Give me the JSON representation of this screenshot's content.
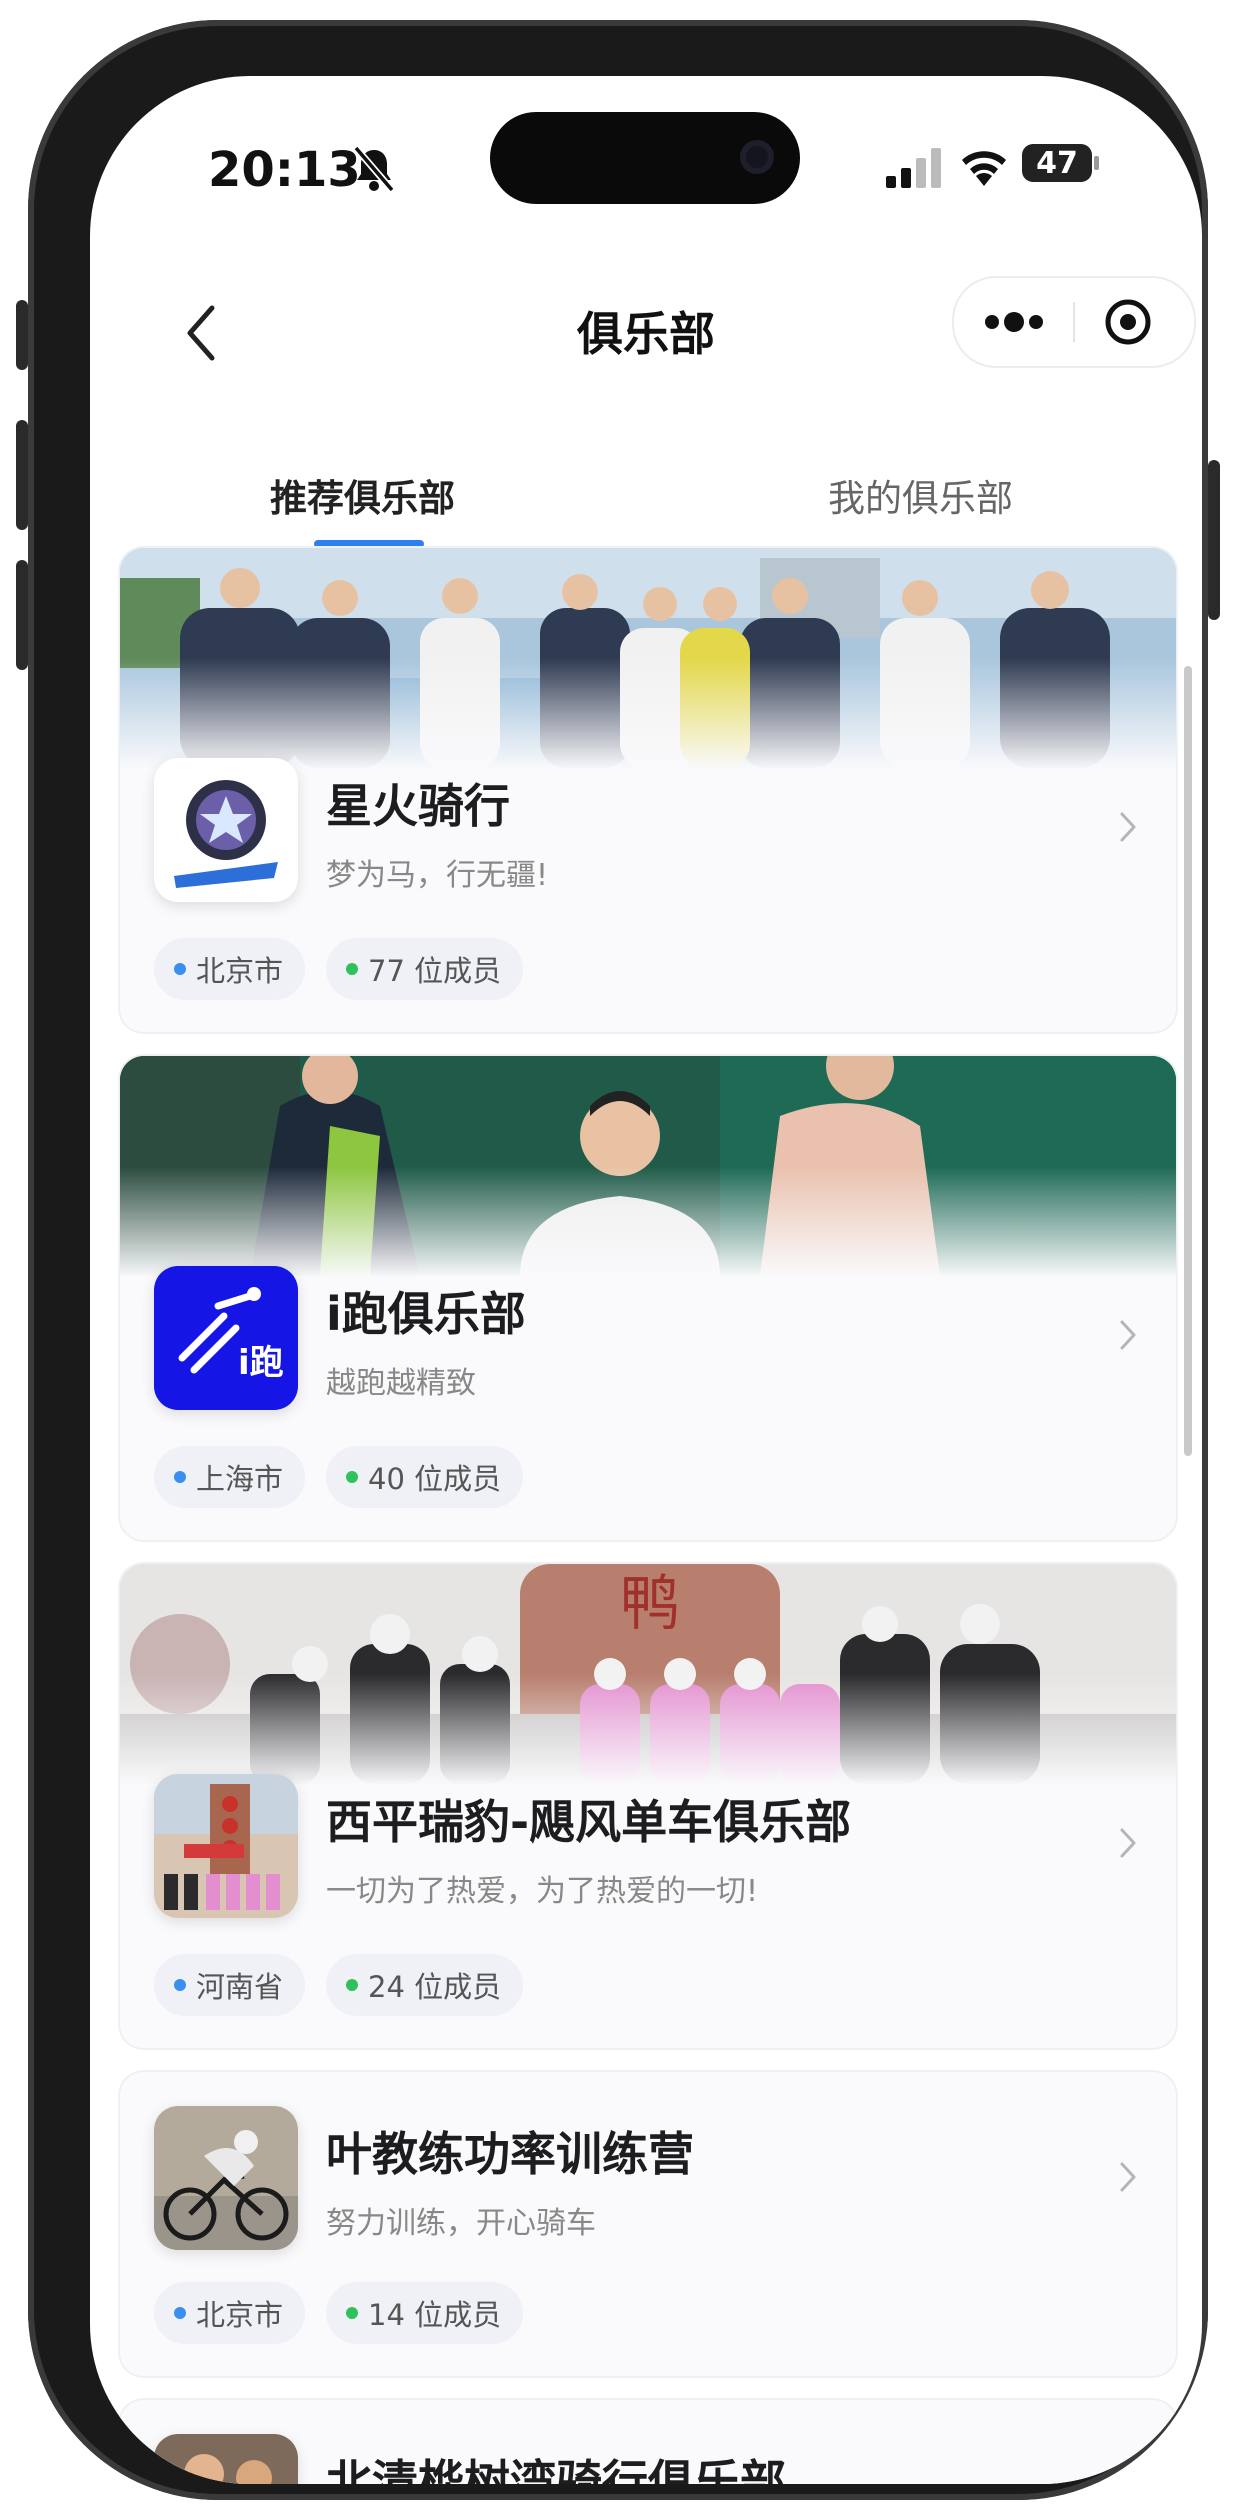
{
  "status_bar": {
    "time": "20:13",
    "battery": "47"
  },
  "nav": {
    "title": "俱乐部"
  },
  "tabs": [
    {
      "label": "推荐俱乐部",
      "active": true
    },
    {
      "label": "我的俱乐部",
      "active": false
    }
  ],
  "colors": {
    "accent": "#2f7ff0",
    "location_dot": "#3a8ef0",
    "members_dot": "#2fc25b"
  },
  "clubs": [
    {
      "name": "星火骑行",
      "slogan": "梦为马，行无疆!",
      "location": "北京市",
      "members": "77 位成员"
    },
    {
      "name": "i跑俱乐部",
      "slogan": "越跑越精致",
      "location": "上海市",
      "members": "40 位成员",
      "logo_text": "i跑"
    },
    {
      "name": "西平瑞豹-飓风单车俱乐部",
      "slogan": "一切为了热爱，为了热爱的一切!",
      "location": "河南省",
      "members": "24 位成员"
    },
    {
      "name": "叶教练功率训练营",
      "slogan": "努力训练，开心骑车",
      "location": "北京市",
      "members": "14 位成员"
    },
    {
      "name": "北清桦树湾骑行俱乐部"
    }
  ]
}
